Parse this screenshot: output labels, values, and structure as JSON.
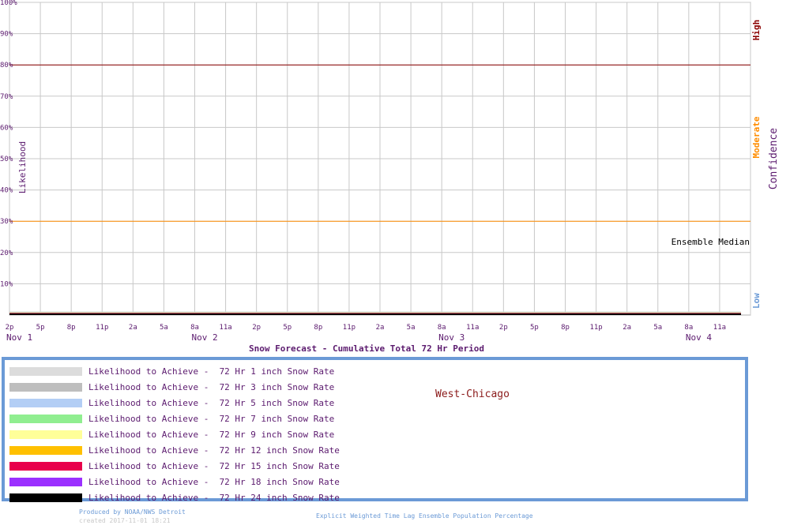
{
  "chart_data": {
    "type": "line",
    "title": "Snow Forecast - Cumulative Total 72 Hr Period",
    "ylabel": "Likelihood",
    "y_ticks": [
      "100%",
      "90%",
      "80%",
      "70%",
      "60%",
      "50%",
      "40%",
      "30%",
      "20%",
      "10%"
    ],
    "y_tick_values": [
      100,
      90,
      80,
      70,
      60,
      50,
      40,
      30,
      20,
      10
    ],
    "ylim": [
      0,
      100
    ],
    "x_tick_labels": [
      "2p",
      "5p",
      "8p",
      "11p",
      "2a",
      "5a",
      "8a",
      "11a",
      "2p",
      "5p",
      "8p",
      "11p",
      "2a",
      "5a",
      "8a",
      "11a",
      "2p",
      "5p",
      "8p",
      "11p",
      "2a",
      "5a",
      "8a",
      "11a"
    ],
    "date_labels": [
      "Nov  1",
      "Nov  2",
      "Nov  3",
      "Nov  4"
    ],
    "date_label_tick_index": [
      0,
      6,
      14,
      22
    ],
    "confidence": {
      "title": "Confidence",
      "high_label": "High",
      "moderate_label": "Moderate",
      "low_label": "Low",
      "high_threshold": 80,
      "low_threshold": 30,
      "high_color": "#8b0000",
      "moderate_color": "#ff8c00",
      "low_color": "#6b9ad6"
    },
    "annotation": "Ensemble Median",
    "grid": true,
    "series": [
      {
        "name": "Likelihood to Achieve -  72 Hr 1 inch Snow Rate",
        "color": "#dcdcdc",
        "value": 0
      },
      {
        "name": "Likelihood to Achieve -  72 Hr 3 inch Snow Rate",
        "color": "#bebebe",
        "value": 0
      },
      {
        "name": "Likelihood to Achieve -  72 Hr 5 inch Snow Rate",
        "color": "#b3cef5",
        "value": 0
      },
      {
        "name": "Likelihood to Achieve -  72 Hr 7 inch Snow Rate",
        "color": "#90ee90",
        "value": 0
      },
      {
        "name": "Likelihood to Achieve -  72 Hr 9 inch Snow Rate",
        "color": "#ffff99",
        "value": 0
      },
      {
        "name": "Likelihood to Achieve -  72 Hr 12 inch Snow Rate",
        "color": "#ffc000",
        "value": 0
      },
      {
        "name": "Likelihood to Achieve -  72 Hr 15 inch Snow Rate",
        "color": "#e8004c",
        "value": 0
      },
      {
        "name": "Likelihood to Achieve -  72 Hr 18 inch Snow Rate",
        "color": "#9b30ff",
        "value": 0
      },
      {
        "name": "Likelihood to Achieve -  72 Hr 24 inch Snow Rate",
        "color": "#000000",
        "value": 0
      }
    ]
  },
  "legend": {
    "location": "West-Chicago"
  },
  "footer": {
    "produced_by": "Produced by NOAA/NWS Detroit",
    "created": "created 2017-11-01 18:21",
    "method": "Explicit Weighted Time Lag Ensemble Population Percentage"
  }
}
